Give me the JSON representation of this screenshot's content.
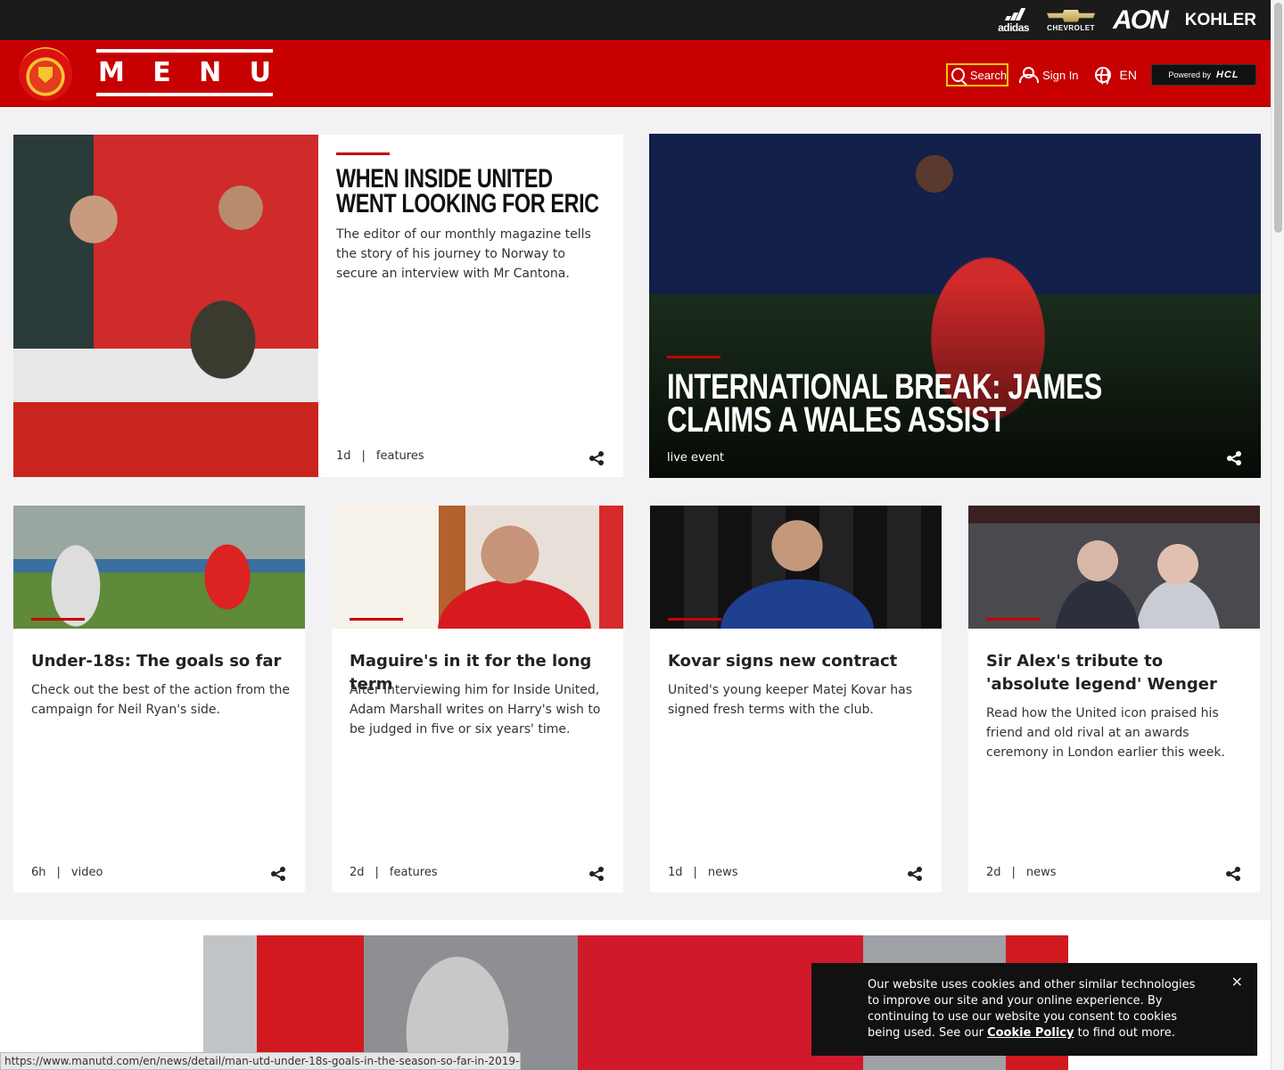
{
  "sponsors": [
    "adidas",
    "CHEVROLET",
    "AON",
    "KOHLER"
  ],
  "header": {
    "menu_letters": [
      "M",
      "E",
      "N",
      "U"
    ],
    "search_label": "Search",
    "signin_label": "Sign In",
    "lang_label": "EN",
    "powered_by": "Powered by",
    "powered_brand": "HCL"
  },
  "featured": [
    {
      "title": "When Inside United went looking for Eric",
      "description": "The editor of our monthly magazine tells the story of his journey to Norway to secure an interview with Mr Cantona.",
      "time": "1d",
      "category": "features"
    },
    {
      "title": "International break: James claims a Wales assist",
      "category": "live event"
    }
  ],
  "cards": [
    {
      "title": "Under-18s: The goals so far",
      "description": "Check out the best of the action from the campaign for Neil Ryan's side.",
      "time": "6h",
      "category": "video"
    },
    {
      "title": "Maguire's in it for the long term",
      "description": "After interviewing him for Inside United, Adam Marshall writes on Harry's wish to be judged in five or six years' time.",
      "time": "2d",
      "category": "features"
    },
    {
      "title": "Kovar signs new contract",
      "description": "United's young keeper Matej Kovar has signed fresh terms with the club.",
      "time": "1d",
      "category": "news"
    },
    {
      "title": "Sir Alex's tribute to 'absolute legend' Wenger",
      "description": "Read how the United icon praised his friend and old rival at an awards ceremony in London earlier this week.",
      "time": "2d",
      "category": "news"
    }
  ],
  "cookie": {
    "text": "Our website uses cookies and other similar technologies to improve our site and your online experience. By continuing to use our website you consent to cookies being used. See our",
    "link": "Cookie Policy",
    "text_after": "to find out more.",
    "close": "×"
  },
  "status_url": "https://www.manutd.com/en/news/detail/man-utd-under-18s-goals-in-the-season-so-far-in-2019-20",
  "colors": {
    "brand_red": "#c70101",
    "search_outline": "#f1c40f"
  }
}
